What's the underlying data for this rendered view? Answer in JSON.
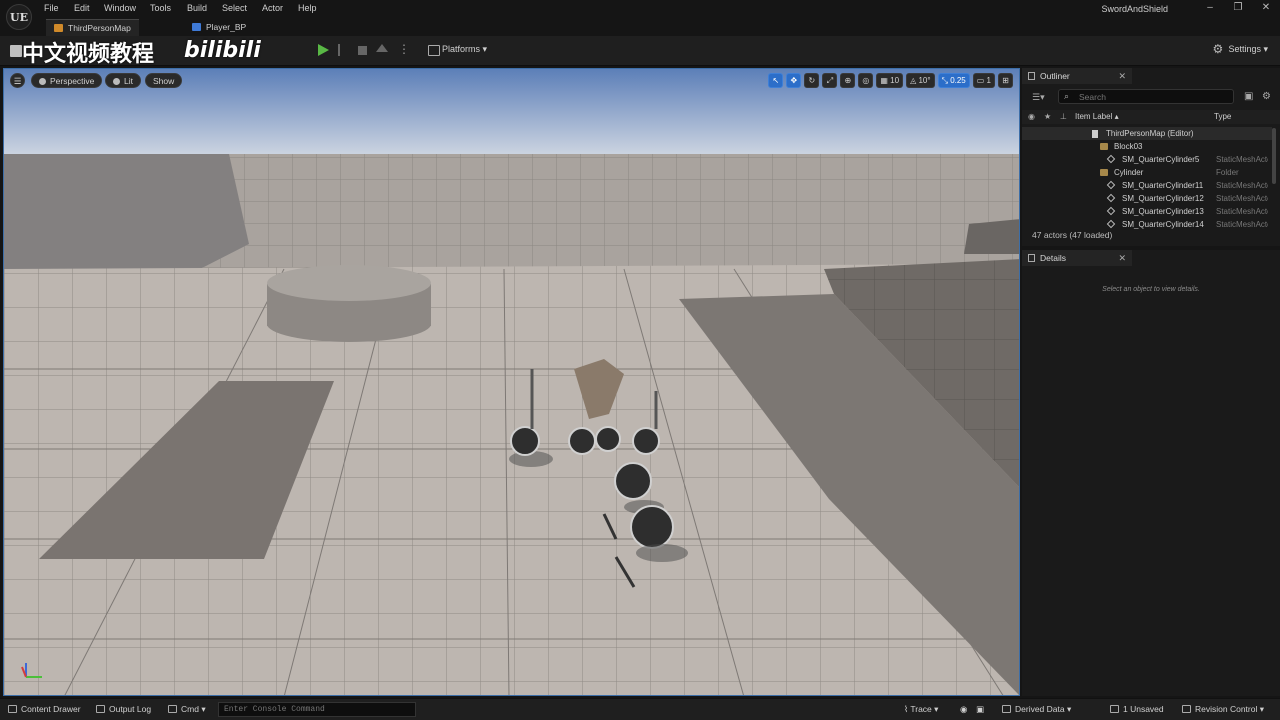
{
  "menubar": {
    "logo": "UE",
    "items": [
      "File",
      "Edit",
      "Window",
      "Tools",
      "Build",
      "Select",
      "Actor",
      "Help"
    ],
    "project_name": "SwordAndShield",
    "window_controls": [
      "–",
      "❐",
      "✕"
    ]
  },
  "tabs": [
    {
      "label": "ThirdPersonMap",
      "active": true
    },
    {
      "label": "Player_BP",
      "active": false
    }
  ],
  "toolbar": {
    "watermark": "中文视频教程",
    "watermark_logo": "bilibili",
    "platforms_label": "Platforms",
    "settings_label": "Settings",
    "more_symbol": "⋮"
  },
  "viewport": {
    "menu_symbol": "☰",
    "perspective_label": "Perspective",
    "lit_label": "Lit",
    "show_label": "Show",
    "grid_snap": "10",
    "rotation_snap": "10°",
    "scale_snap": "0.25",
    "camera_speed": "1"
  },
  "outliner": {
    "title": "Outliner",
    "close": "✕",
    "search_placeholder": "Search",
    "col_label": "Item Label ▴",
    "col_type": "Type",
    "rows": [
      {
        "label": "ThirdPersonMap (Editor)",
        "type": "",
        "indent": 70,
        "icon": "map"
      },
      {
        "label": "Block03",
        "type": "",
        "indent": 78,
        "icon": "folder"
      },
      {
        "label": "SM_QuarterCylinder5",
        "type": "StaticMeshActor",
        "indent": 86,
        "icon": "mesh"
      },
      {
        "label": "Cylinder",
        "type": "Folder",
        "indent": 78,
        "icon": "folder"
      },
      {
        "label": "SM_QuarterCylinder11",
        "type": "StaticMeshActor",
        "indent": 86,
        "icon": "mesh"
      },
      {
        "label": "SM_QuarterCylinder12",
        "type": "StaticMeshActor",
        "indent": 86,
        "icon": "mesh"
      },
      {
        "label": "SM_QuarterCylinder13",
        "type": "StaticMeshActor",
        "indent": 86,
        "icon": "mesh"
      },
      {
        "label": "SM_QuarterCylinder14",
        "type": "StaticMeshActor",
        "indent": 86,
        "icon": "mesh"
      }
    ],
    "actor_count": "47 actors (47 loaded)"
  },
  "details": {
    "title": "Details",
    "close": "✕",
    "empty_message": "Select an object to view details."
  },
  "statusbar": {
    "content_drawer": "Content Drawer",
    "output_log": "Output Log",
    "cmd": "Cmd",
    "console_placeholder": "Enter Console Command",
    "trace": "Trace",
    "derived_data": "Derived Data",
    "unsaved": "1 Unsaved",
    "revision_control": "Revision Control"
  },
  "colors": {
    "play_green": "#59b845",
    "selection_blue": "#2c6ec9",
    "panel_bg": "#1a1a1a",
    "folder": "#a6884a"
  }
}
